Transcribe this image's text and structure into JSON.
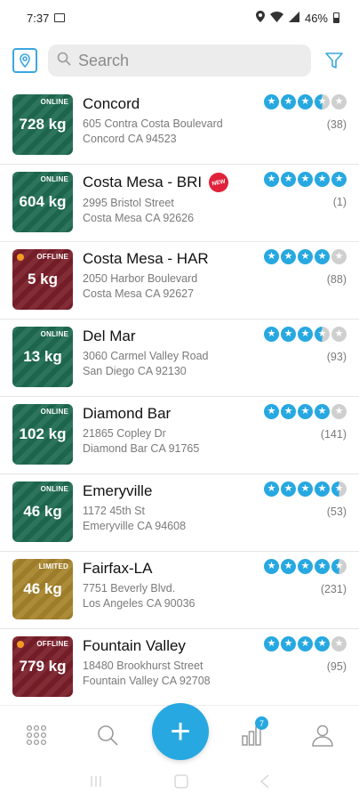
{
  "status_bar": {
    "time": "7:37",
    "battery": "46%"
  },
  "search": {
    "placeholder": "Search"
  },
  "stores": [
    {
      "name": "Concord",
      "status": "ONLINE",
      "kg": "728 kg",
      "address1": "605 Contra Costa Boulevard",
      "address2": "Concord CA 94523",
      "rating": 3.5,
      "reviews": "(38)",
      "color": "#1f6b52",
      "is_new": false
    },
    {
      "name": "Costa Mesa - BRI",
      "status": "ONLINE",
      "kg": "604 kg",
      "address1": "2995 Bristol Street",
      "address2": "Costa Mesa CA 92626",
      "rating": 5,
      "reviews": "(1)",
      "color": "#1f6b52",
      "is_new": true,
      "new_label": "NEW"
    },
    {
      "name": "Costa Mesa - HAR",
      "status": "OFFLINE",
      "kg": "5 kg",
      "address1": "2050 Harbor Boulevard",
      "address2": "Costa Mesa CA 92627",
      "rating": 4,
      "reviews": "(88)",
      "color": "#7a1f2a",
      "is_new": false
    },
    {
      "name": "Del Mar",
      "status": "ONLINE",
      "kg": "13 kg",
      "address1": "3060 Carmel Valley Road",
      "address2": "San Diego CA 92130",
      "rating": 3.5,
      "reviews": "(93)",
      "color": "#1f6b52",
      "is_new": false
    },
    {
      "name": "Diamond Bar",
      "status": "ONLINE",
      "kg": "102 kg",
      "address1": "21865 Copley Dr",
      "address2": "Diamond Bar CA 91765",
      "rating": 4,
      "reviews": "(141)",
      "color": "#1f6b52",
      "is_new": false
    },
    {
      "name": "Emeryville",
      "status": "ONLINE",
      "kg": "46 kg",
      "address1": "1172 45th St",
      "address2": "Emeryville CA 94608",
      "rating": 4.5,
      "reviews": "(53)",
      "color": "#1f6b52",
      "is_new": false
    },
    {
      "name": "Fairfax-LA",
      "status": "LIMITED",
      "kg": "46 kg",
      "address1": "7751 Beverly Blvd.",
      "address2": "Los Angeles CA  90036",
      "rating": 4.5,
      "reviews": "(231)",
      "color": "#a7842d",
      "is_new": false
    },
    {
      "name": "Fountain Valley",
      "status": "OFFLINE",
      "kg": "779 kg",
      "address1": "18480 Brookhurst Street",
      "address2": "Fountain Valley CA 92708",
      "rating": 4,
      "reviews": "(95)",
      "color": "#7a1f2a",
      "is_new": false
    }
  ],
  "bottom_nav": {
    "stats_badge": "7",
    "add_symbol": "+"
  },
  "colors": {
    "accent": "#27a8e0",
    "star_on": "#27a8e0",
    "star_off": "#cfcfcf",
    "online": "#1f6b52",
    "offline": "#7a1f2a",
    "limited": "#a7842d",
    "offline_dot": "#f59a23"
  },
  "icons": [
    "map-icon",
    "search-icon",
    "filter-icon",
    "grid-icon",
    "search-icon",
    "plus-icon",
    "bar-chart-icon",
    "profile-icon"
  ]
}
